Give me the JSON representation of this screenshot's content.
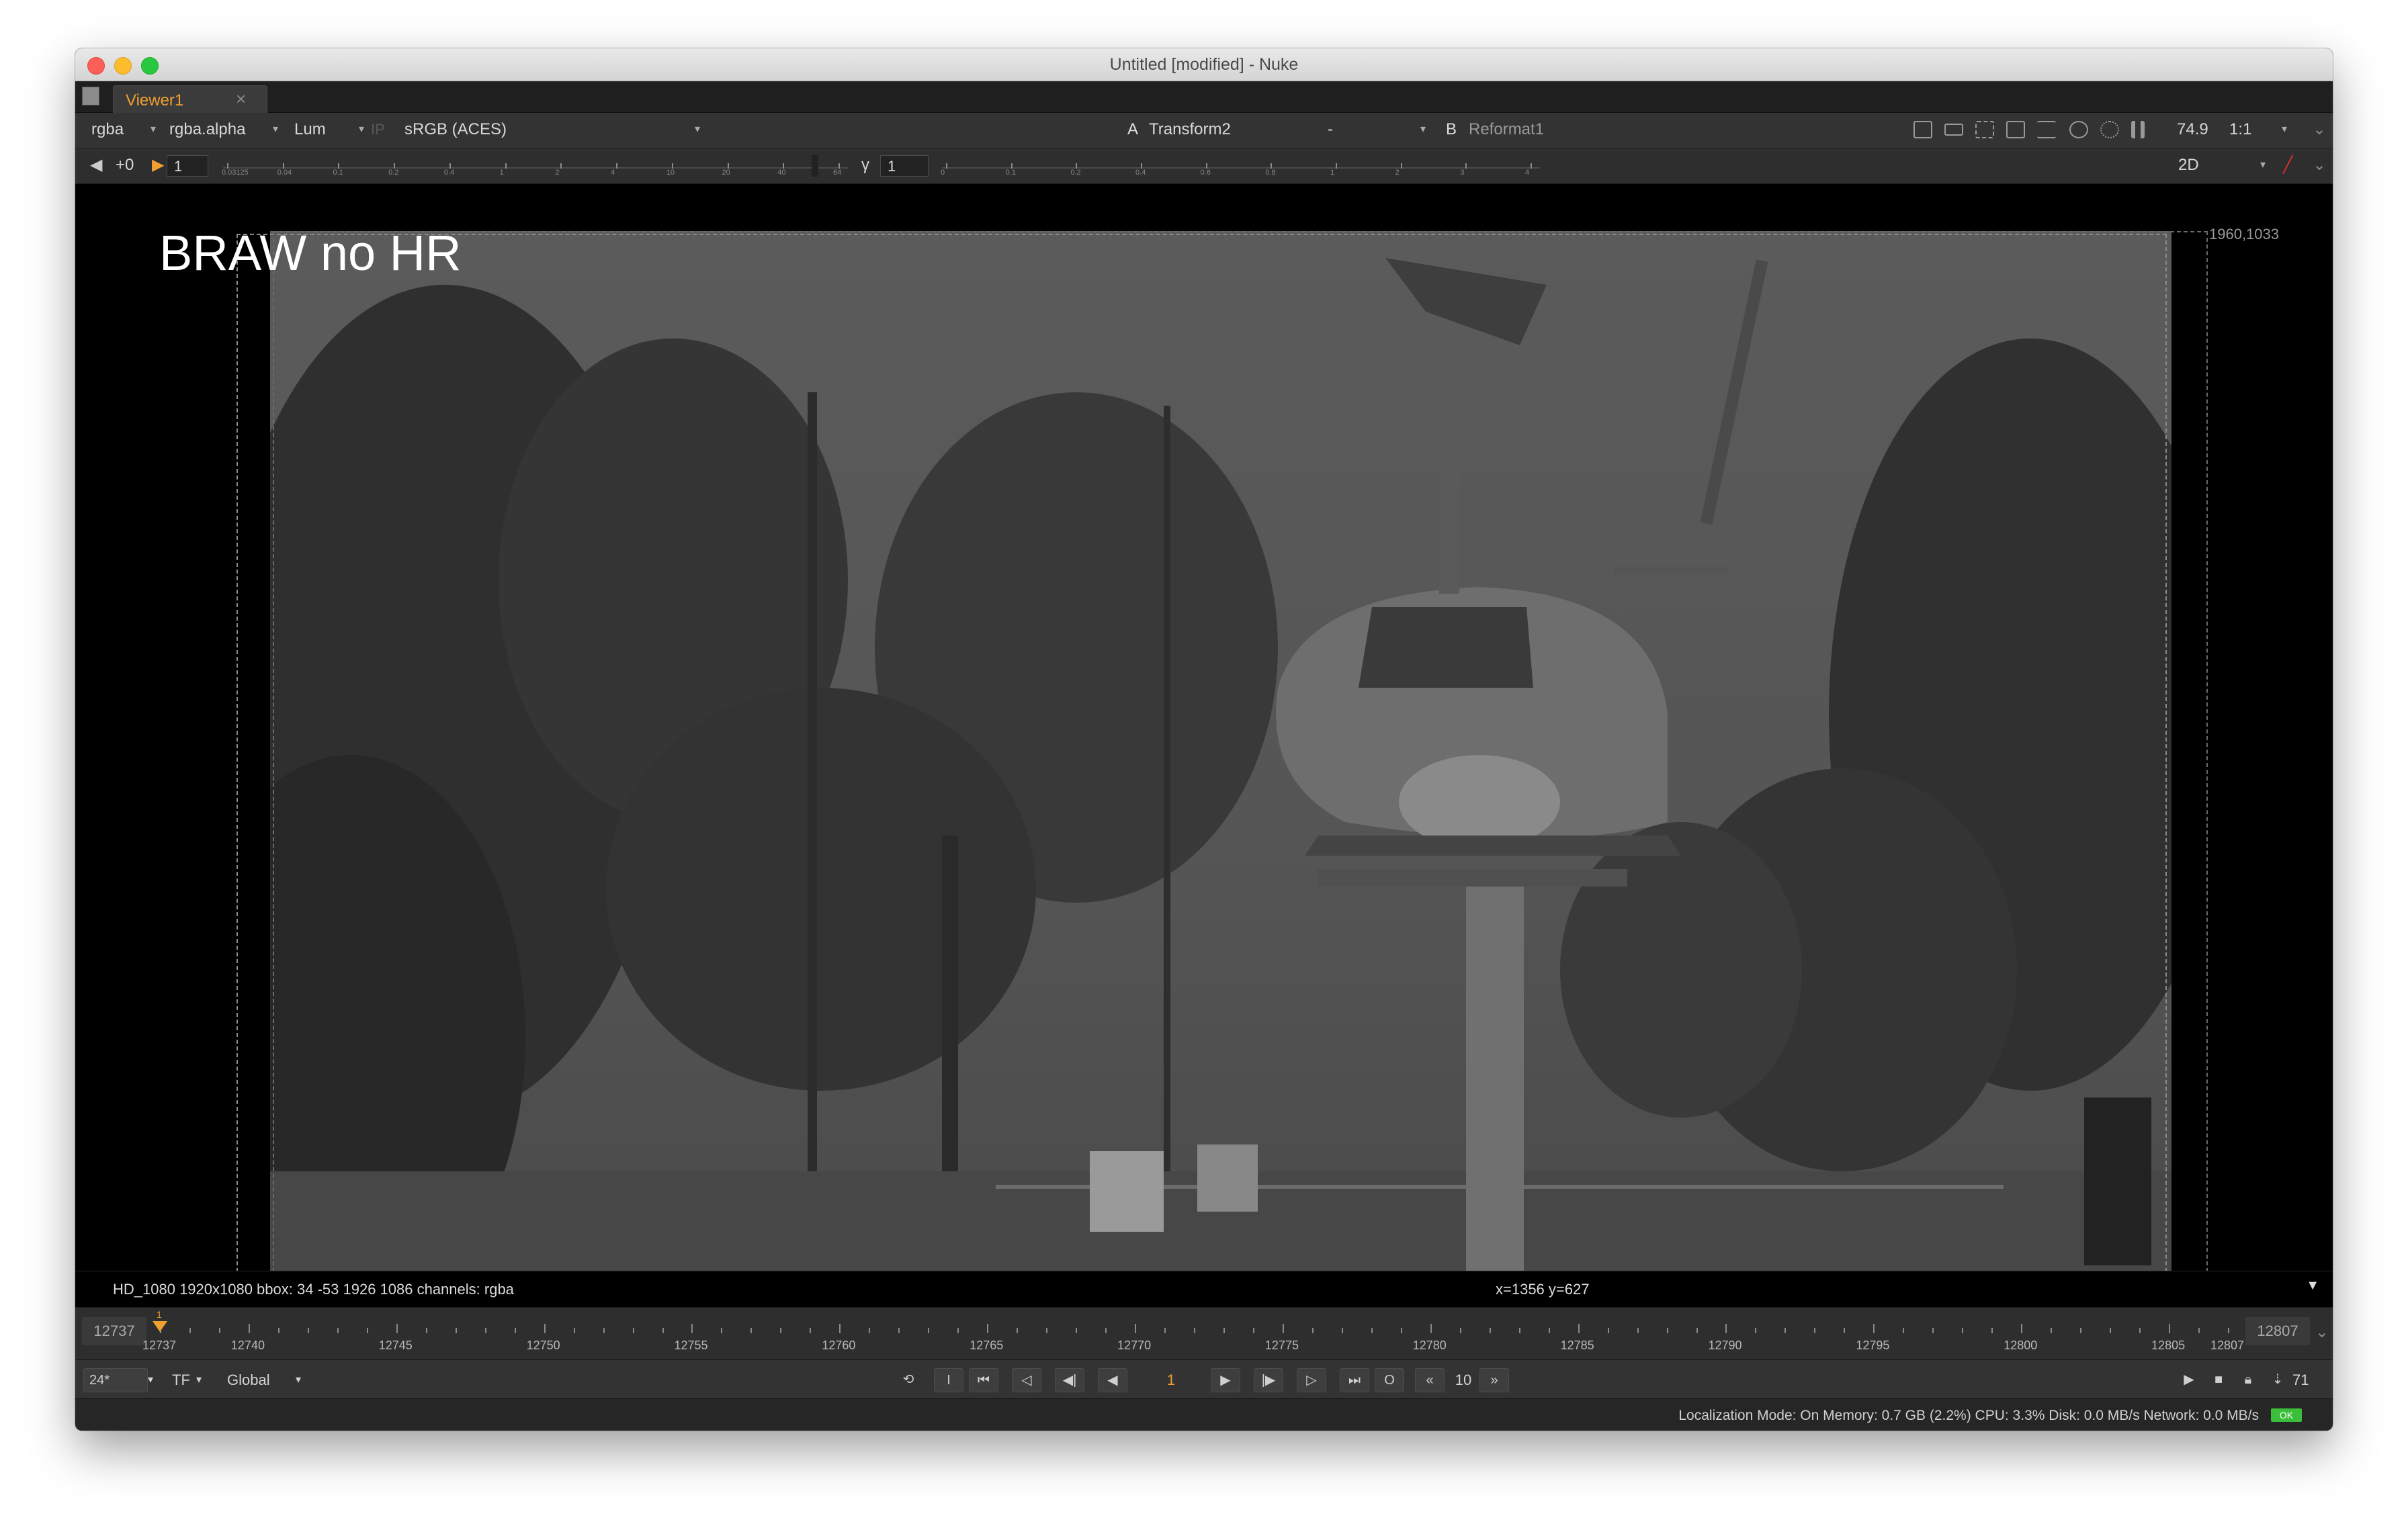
{
  "window": {
    "title": "Untitled [modified] - Nuke"
  },
  "tabs": [
    {
      "label": "Viewer1",
      "close": "×"
    }
  ],
  "toolbar": {
    "channels": "rgba",
    "alpha": "rgba.alpha",
    "display": "Lum",
    "ip": "IP",
    "colorspace": "sRGB (ACES)",
    "input_a_label": "A",
    "input_a": "Transform2",
    "composite": "-",
    "input_b_label": "B",
    "input_b": "Reformat1",
    "zoom": "74.9",
    "proxy": "1:1"
  },
  "toolbar2": {
    "fstop": "+0",
    "gain": "1",
    "gamma_label": "γ",
    "gamma": "1",
    "view_mode": "2D",
    "gain_ticks": [
      "0.03125",
      "0.04",
      "0.1",
      "0.2",
      "0.4",
      "1",
      "2",
      "4",
      "10",
      "20",
      "40",
      "64"
    ],
    "gamma_ticks": [
      "0",
      "0.1",
      "0.2",
      "0.4",
      "0.6",
      "0.8",
      "1",
      "2",
      "3",
      "4"
    ]
  },
  "viewer": {
    "overlay_text": "BRAW no HR",
    "resolution_label": "1960,1033"
  },
  "infobar": {
    "format": "HD_1080 1920x1080  bbox: 34 -53 1926 1086 channels: rgba",
    "cursor": "x=1356 y=627"
  },
  "timeline": {
    "start": "12737",
    "end": "12807",
    "current": "12737",
    "marker_label": "1",
    "labels": [
      "12737",
      "12740",
      "12745",
      "12750",
      "12755",
      "12760",
      "12765",
      "12770",
      "12775",
      "12780",
      "12785",
      "12790",
      "12795",
      "12800",
      "12805",
      "12807"
    ]
  },
  "controls": {
    "fps": "24*",
    "time_format": "TF",
    "range": "Global",
    "in_button": "I",
    "out_button": "O",
    "current_frame": "1",
    "step": "10",
    "frame_count": "71"
  },
  "status": {
    "text": "Localization Mode: On  Memory: 0.7 GB (2.2%)  CPU: 3.3%  Disk: 0.0 MB/s  Network: 0.0 MB/s",
    "ok": "OK"
  },
  "colors": {
    "accent": "#f0a030",
    "ok": "#3bbf3b",
    "viewer_bg": "#000000"
  }
}
